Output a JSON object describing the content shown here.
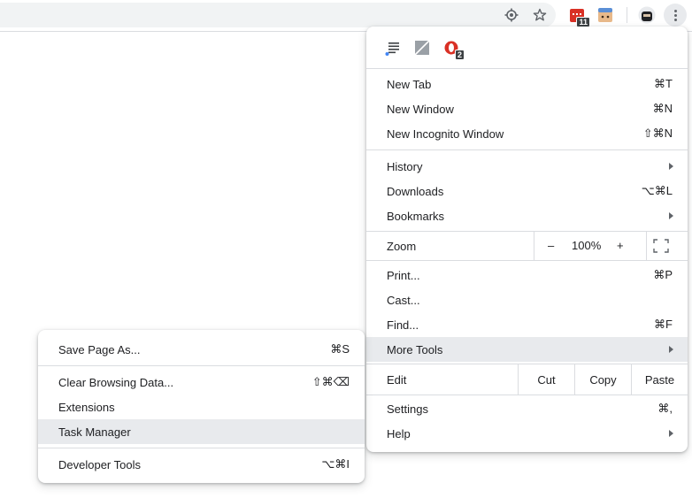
{
  "toolbar": {
    "icons": [
      "location-target-icon",
      "bookmark-star-icon",
      "extension-calendar-icon",
      "extension-face-icon",
      "profile-avatar-icon",
      "chrome-menu-icon"
    ],
    "extension_badge": "11",
    "colors": {
      "omnibox_bg": "#f1f3f4",
      "border": "#dadce0",
      "menu_button_bg": "#e8eaed"
    }
  },
  "main_menu": {
    "extensions": [
      {
        "icon": "reader-lines-icon"
      },
      {
        "icon": "no-image-icon"
      },
      {
        "icon": "opera-red-icon",
        "badge": "2"
      }
    ],
    "new_tab": {
      "label": "New Tab",
      "shortcut": "⌘T"
    },
    "new_window": {
      "label": "New Window",
      "shortcut": "⌘N"
    },
    "new_incognito": {
      "label": "New Incognito Window",
      "shortcut": "⇧⌘N"
    },
    "history": {
      "label": "History"
    },
    "downloads": {
      "label": "Downloads",
      "shortcut": "⌥⌘L"
    },
    "bookmarks": {
      "label": "Bookmarks"
    },
    "zoom": {
      "label": "Zoom",
      "minus": "–",
      "value": "100%",
      "plus": "+"
    },
    "print": {
      "label": "Print...",
      "shortcut": "⌘P"
    },
    "cast": {
      "label": "Cast..."
    },
    "find": {
      "label": "Find...",
      "shortcut": "⌘F"
    },
    "more_tools": {
      "label": "More Tools"
    },
    "edit": {
      "label": "Edit",
      "cut": "Cut",
      "copy": "Copy",
      "paste": "Paste"
    },
    "settings": {
      "label": "Settings",
      "shortcut": "⌘,"
    },
    "help": {
      "label": "Help"
    }
  },
  "more_tools_menu": {
    "save_page": {
      "label": "Save Page As...",
      "shortcut": "⌘S"
    },
    "clear_browsing": {
      "label": "Clear Browsing Data...",
      "shortcut": "⇧⌘⌫"
    },
    "extensions": {
      "label": "Extensions"
    },
    "task_manager": {
      "label": "Task Manager"
    },
    "developer_tools": {
      "label": "Developer Tools",
      "shortcut": "⌥⌘I"
    }
  },
  "colors": {
    "highlight": "#e8eaed",
    "text": "#202124",
    "separator": "#dadce0"
  }
}
